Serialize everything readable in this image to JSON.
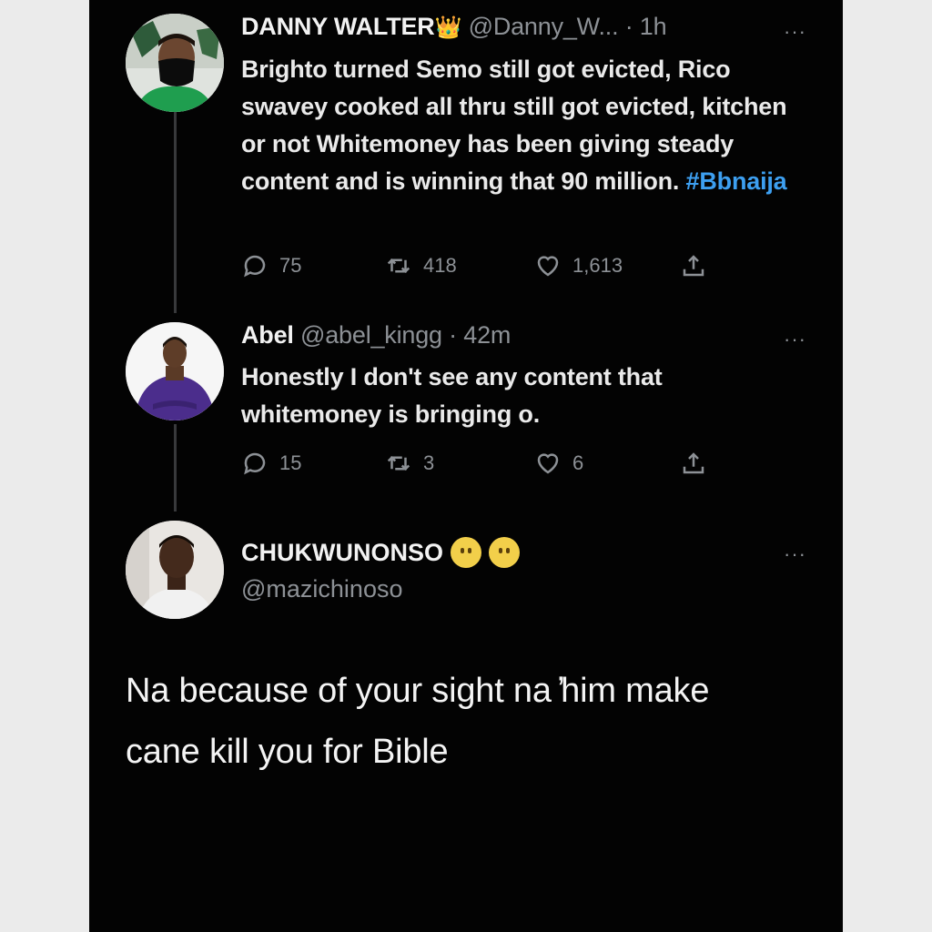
{
  "tweet1": {
    "name": "DANNY WALTER",
    "badge": "👑",
    "handle": "@Danny_W...",
    "time": "· 1h",
    "more": "···",
    "text_before_hashtag": "Brighto turned Semo still got evicted, Rico swavey cooked all thru still got evicted, kitchen or not Whitemoney has been giving steady content and is winning that 90 million.",
    "hashtag": "#Bbnaija",
    "replies": "75",
    "retweets": "418",
    "likes": "1,613"
  },
  "tweet2": {
    "name": "Abel",
    "handle": "@abel_kingg",
    "time": "· 42m",
    "more": "···",
    "text": "Honestly I don't see any content that whitemoney is bringing o.",
    "replies": "15",
    "retweets": "3",
    "likes": "6"
  },
  "reply": {
    "name": "CHUKWUNONSO",
    "handle": "@mazichinoso",
    "more": "···",
    "text": "Na because of your sight na ̓him make cane kill you for Bible"
  },
  "colors": {
    "background": "#030303",
    "hashtag": "#3d9ff0",
    "muted": "#8d9196"
  }
}
